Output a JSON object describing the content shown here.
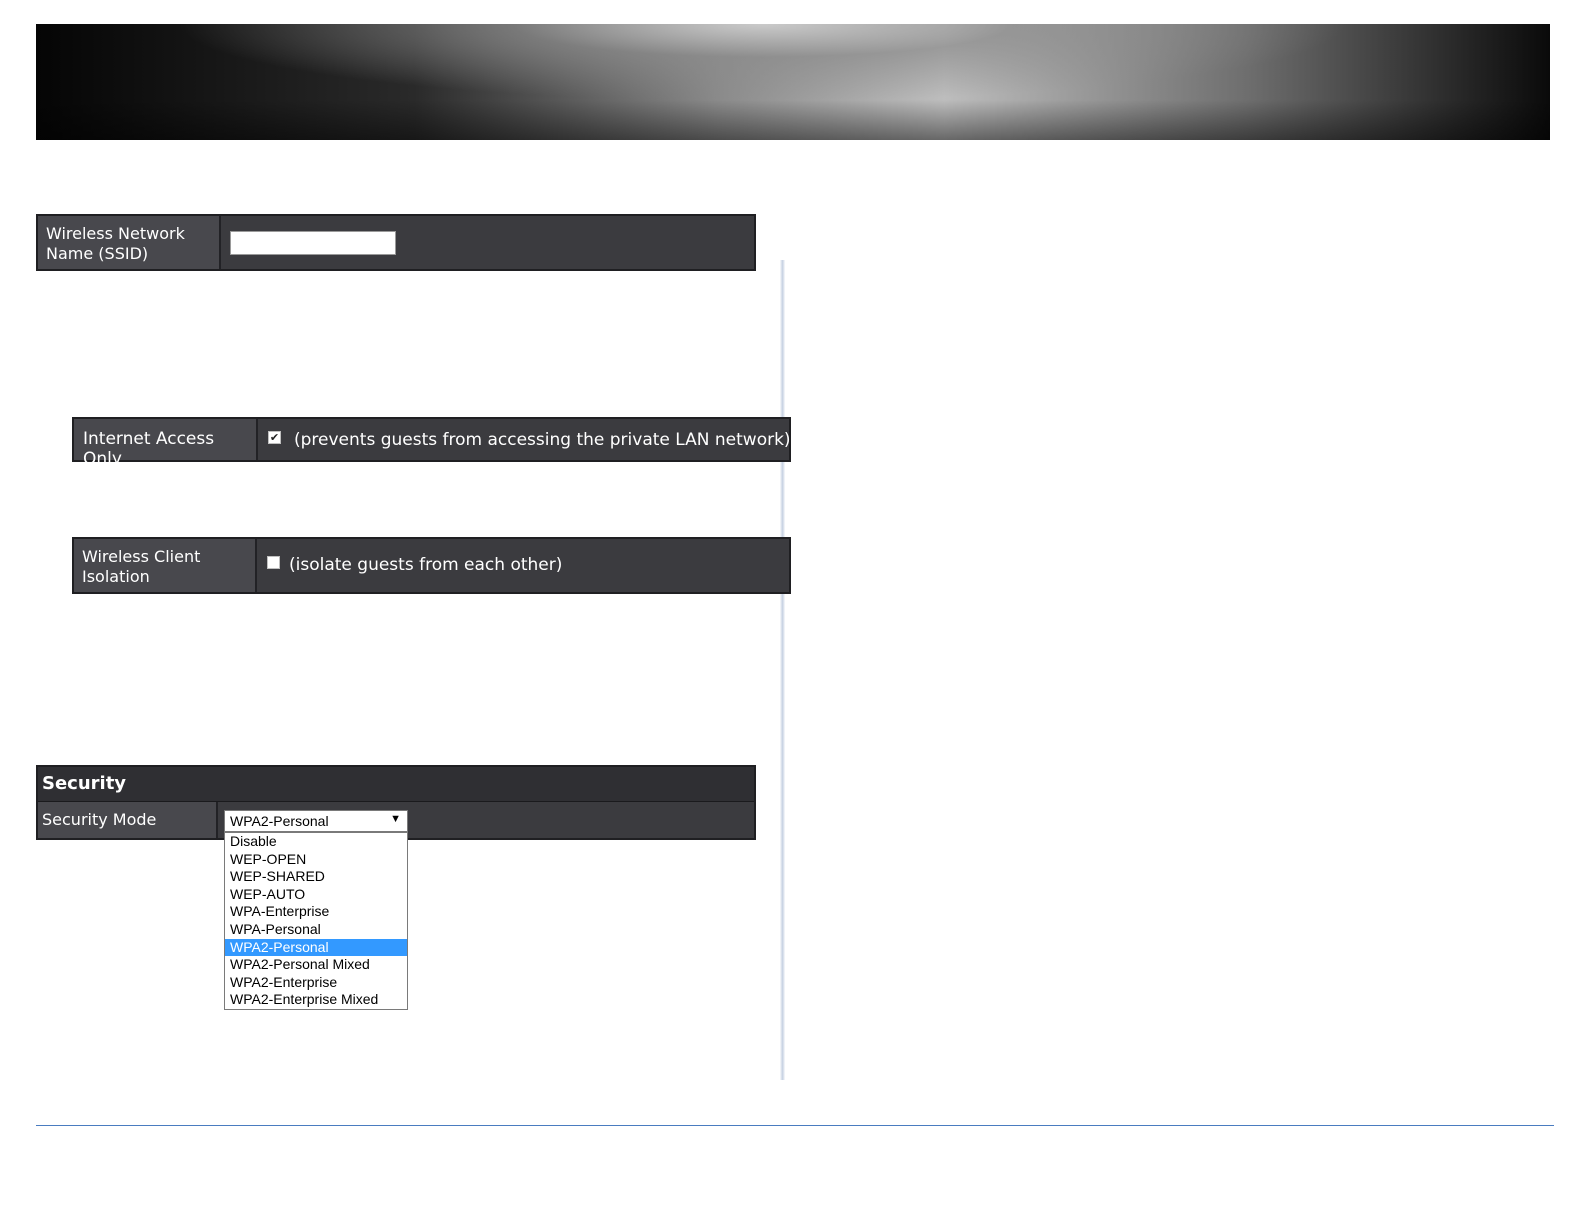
{
  "ssid_section": {
    "label": "Wireless Network Name (SSID)",
    "value": ""
  },
  "internet_access": {
    "label": "Internet Access Only",
    "checked": true,
    "description": "(prevents guests from accessing the private LAN network)"
  },
  "client_isolation": {
    "label": "Wireless Client Isolation",
    "checked": false,
    "description": "(isolate guests from each other)"
  },
  "security": {
    "header": "Security",
    "mode_label": "Security Mode",
    "selected": "WPA2-Personal",
    "options": [
      "Disable",
      "WEP-OPEN",
      "WEP-SHARED",
      "WEP-AUTO",
      "WPA-Enterprise",
      "WPA-Personal",
      "WPA2-Personal",
      "WPA2-Personal Mixed",
      "WPA2-Enterprise",
      "WPA2-Enterprise Mixed"
    ]
  },
  "icons": {
    "checkbox_checked": "checkmark-icon",
    "dropdown_arrow": "triangle-down-icon"
  },
  "colors": {
    "panel_bg": "#3b3b3f",
    "label_bg": "#48484d",
    "highlight": "#3399ff",
    "footer_line": "#4a7cc0"
  }
}
